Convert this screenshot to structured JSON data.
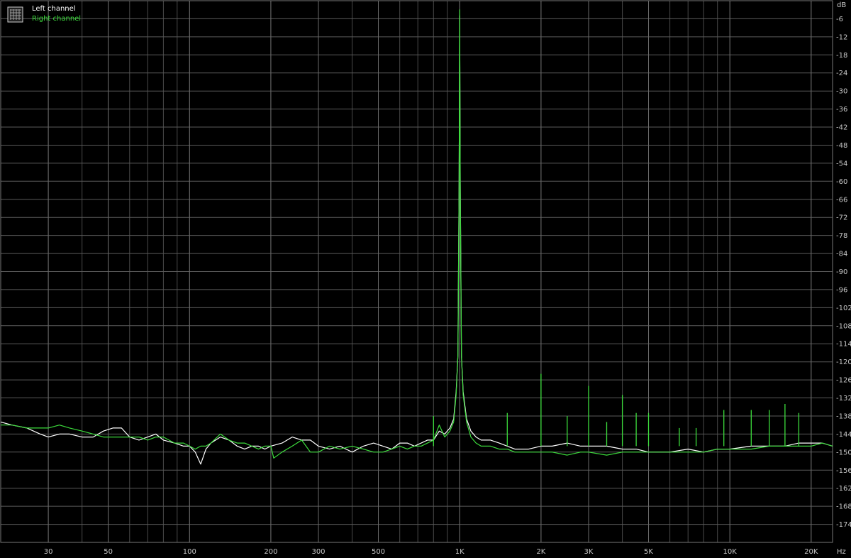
{
  "chart_data": {
    "type": "line",
    "title": "",
    "xlabel": "",
    "ylabel": "",
    "x_scale": "log",
    "x_unit": "Hz",
    "y_unit": "dB",
    "xlim": [
      20,
      24000
    ],
    "ylim": [
      -180,
      0
    ],
    "x_major_labels": [
      "30",
      "50",
      "100",
      "200",
      "300",
      "500",
      "1K",
      "2K",
      "3K",
      "5K",
      "10K",
      "20K"
    ],
    "x_major_values": [
      30,
      50,
      100,
      200,
      300,
      500,
      1000,
      2000,
      3000,
      5000,
      10000,
      20000
    ],
    "y_ticks": [
      -6,
      -12,
      -18,
      -24,
      -30,
      -36,
      -42,
      -48,
      -54,
      -60,
      -66,
      -72,
      -78,
      -84,
      -90,
      -96,
      -102,
      -108,
      -114,
      -120,
      -126,
      -132,
      -138,
      -144,
      -150,
      -156,
      -162,
      -168,
      -174
    ],
    "grid": true,
    "legend_position": "top-left",
    "background": "#000000",
    "grid_color": "#5a5a5a",
    "series": [
      {
        "name": "Left channel",
        "color": "#ffffff",
        "points": [
          [
            20,
            -140
          ],
          [
            22,
            -141
          ],
          [
            25,
            -142
          ],
          [
            28,
            -144
          ],
          [
            30,
            -145
          ],
          [
            33,
            -144
          ],
          [
            36,
            -144
          ],
          [
            40,
            -145
          ],
          [
            44,
            -145
          ],
          [
            48,
            -143
          ],
          [
            52,
            -142
          ],
          [
            56,
            -142
          ],
          [
            60,
            -145
          ],
          [
            65,
            -146
          ],
          [
            70,
            -145
          ],
          [
            75,
            -144
          ],
          [
            80,
            -146
          ],
          [
            88,
            -147
          ],
          [
            95,
            -148
          ],
          [
            100,
            -148
          ],
          [
            105,
            -150
          ],
          [
            110,
            -154
          ],
          [
            115,
            -149
          ],
          [
            120,
            -147
          ],
          [
            130,
            -145
          ],
          [
            140,
            -146
          ],
          [
            150,
            -148
          ],
          [
            160,
            -149
          ],
          [
            170,
            -148
          ],
          [
            180,
            -148
          ],
          [
            190,
            -149
          ],
          [
            200,
            -148
          ],
          [
            220,
            -147
          ],
          [
            240,
            -145
          ],
          [
            260,
            -146
          ],
          [
            280,
            -146
          ],
          [
            300,
            -148
          ],
          [
            330,
            -149
          ],
          [
            360,
            -148
          ],
          [
            400,
            -150
          ],
          [
            440,
            -148
          ],
          [
            480,
            -147
          ],
          [
            520,
            -148
          ],
          [
            560,
            -149
          ],
          [
            600,
            -147
          ],
          [
            640,
            -147
          ],
          [
            680,
            -148
          ],
          [
            720,
            -147
          ],
          [
            760,
            -146
          ],
          [
            800,
            -146
          ],
          [
            840,
            -143
          ],
          [
            880,
            -144
          ],
          [
            920,
            -142
          ],
          [
            950,
            -139
          ],
          [
            970,
            -130
          ],
          [
            985,
            -118
          ],
          [
            995,
            -60
          ],
          [
            1000,
            -5
          ],
          [
            1005,
            -60
          ],
          [
            1015,
            -118
          ],
          [
            1030,
            -130
          ],
          [
            1060,
            -139
          ],
          [
            1100,
            -143
          ],
          [
            1150,
            -145
          ],
          [
            1200,
            -146
          ],
          [
            1300,
            -146
          ],
          [
            1400,
            -147
          ],
          [
            1500,
            -148
          ],
          [
            1600,
            -149
          ],
          [
            1800,
            -149
          ],
          [
            2000,
            -148
          ],
          [
            2200,
            -148
          ],
          [
            2500,
            -147
          ],
          [
            2800,
            -148
          ],
          [
            3000,
            -148
          ],
          [
            3500,
            -148
          ],
          [
            4000,
            -149
          ],
          [
            4500,
            -149
          ],
          [
            5000,
            -150
          ],
          [
            6000,
            -150
          ],
          [
            7000,
            -149
          ],
          [
            8000,
            -150
          ],
          [
            9000,
            -149
          ],
          [
            10000,
            -149
          ],
          [
            12000,
            -148
          ],
          [
            14000,
            -148
          ],
          [
            16000,
            -148
          ],
          [
            18000,
            -147
          ],
          [
            20000,
            -147
          ],
          [
            22000,
            -147
          ],
          [
            24000,
            -148
          ]
        ]
      },
      {
        "name": "Right channel",
        "color": "#3cdc3c",
        "points": [
          [
            20,
            -141
          ],
          [
            22,
            -141
          ],
          [
            25,
            -142
          ],
          [
            28,
            -142
          ],
          [
            30,
            -142
          ],
          [
            33,
            -141
          ],
          [
            36,
            -142
          ],
          [
            40,
            -143
          ],
          [
            44,
            -144
          ],
          [
            48,
            -145
          ],
          [
            52,
            -145
          ],
          [
            56,
            -145
          ],
          [
            60,
            -145
          ],
          [
            65,
            -145
          ],
          [
            70,
            -146
          ],
          [
            75,
            -145
          ],
          [
            80,
            -145
          ],
          [
            88,
            -147
          ],
          [
            95,
            -147
          ],
          [
            100,
            -148
          ],
          [
            105,
            -149
          ],
          [
            110,
            -148
          ],
          [
            115,
            -148
          ],
          [
            120,
            -147
          ],
          [
            130,
            -144
          ],
          [
            140,
            -146
          ],
          [
            150,
            -147
          ],
          [
            160,
            -147
          ],
          [
            170,
            -148
          ],
          [
            180,
            -149
          ],
          [
            190,
            -148
          ],
          [
            200,
            -148
          ],
          [
            205,
            -152
          ],
          [
            220,
            -150
          ],
          [
            240,
            -148
          ],
          [
            260,
            -146
          ],
          [
            280,
            -150
          ],
          [
            300,
            -150
          ],
          [
            330,
            -148
          ],
          [
            360,
            -149
          ],
          [
            400,
            -148
          ],
          [
            440,
            -149
          ],
          [
            480,
            -150
          ],
          [
            520,
            -150
          ],
          [
            560,
            -149
          ],
          [
            600,
            -148
          ],
          [
            640,
            -149
          ],
          [
            680,
            -148
          ],
          [
            720,
            -148
          ],
          [
            760,
            -147
          ],
          [
            800,
            -146
          ],
          [
            840,
            -141
          ],
          [
            880,
            -145
          ],
          [
            920,
            -143
          ],
          [
            950,
            -140
          ],
          [
            970,
            -131
          ],
          [
            985,
            -118
          ],
          [
            995,
            -60
          ],
          [
            1000,
            -3
          ],
          [
            1005,
            -60
          ],
          [
            1015,
            -118
          ],
          [
            1030,
            -131
          ],
          [
            1060,
            -140
          ],
          [
            1100,
            -145
          ],
          [
            1150,
            -147
          ],
          [
            1200,
            -148
          ],
          [
            1300,
            -148
          ],
          [
            1400,
            -149
          ],
          [
            1500,
            -149
          ],
          [
            1600,
            -150
          ],
          [
            1800,
            -150
          ],
          [
            2000,
            -150
          ],
          [
            2200,
            -150
          ],
          [
            2500,
            -151
          ],
          [
            2800,
            -150
          ],
          [
            3000,
            -150
          ],
          [
            3500,
            -151
          ],
          [
            4000,
            -150
          ],
          [
            4500,
            -150
          ],
          [
            5000,
            -150
          ],
          [
            6000,
            -150
          ],
          [
            7000,
            -150
          ],
          [
            8000,
            -150
          ],
          [
            9000,
            -149
          ],
          [
            10000,
            -149
          ],
          [
            12000,
            -149
          ],
          [
            14000,
            -148
          ],
          [
            16000,
            -148
          ],
          [
            18000,
            -148
          ],
          [
            20000,
            -148
          ],
          [
            22000,
            -147
          ],
          [
            24000,
            -148
          ]
        ],
        "spikes": [
          [
            800,
            -138
          ],
          [
            1500,
            -137
          ],
          [
            2000,
            -124
          ],
          [
            2500,
            -138
          ],
          [
            3000,
            -128
          ],
          [
            3500,
            -140
          ],
          [
            4000,
            -131
          ],
          [
            4500,
            -137
          ],
          [
            5000,
            -137
          ],
          [
            6500,
            -142
          ],
          [
            7500,
            -142
          ],
          [
            9500,
            -136
          ],
          [
            12000,
            -136
          ],
          [
            14000,
            -136
          ],
          [
            16000,
            -134
          ],
          [
            18000,
            -137
          ]
        ]
      }
    ]
  }
}
